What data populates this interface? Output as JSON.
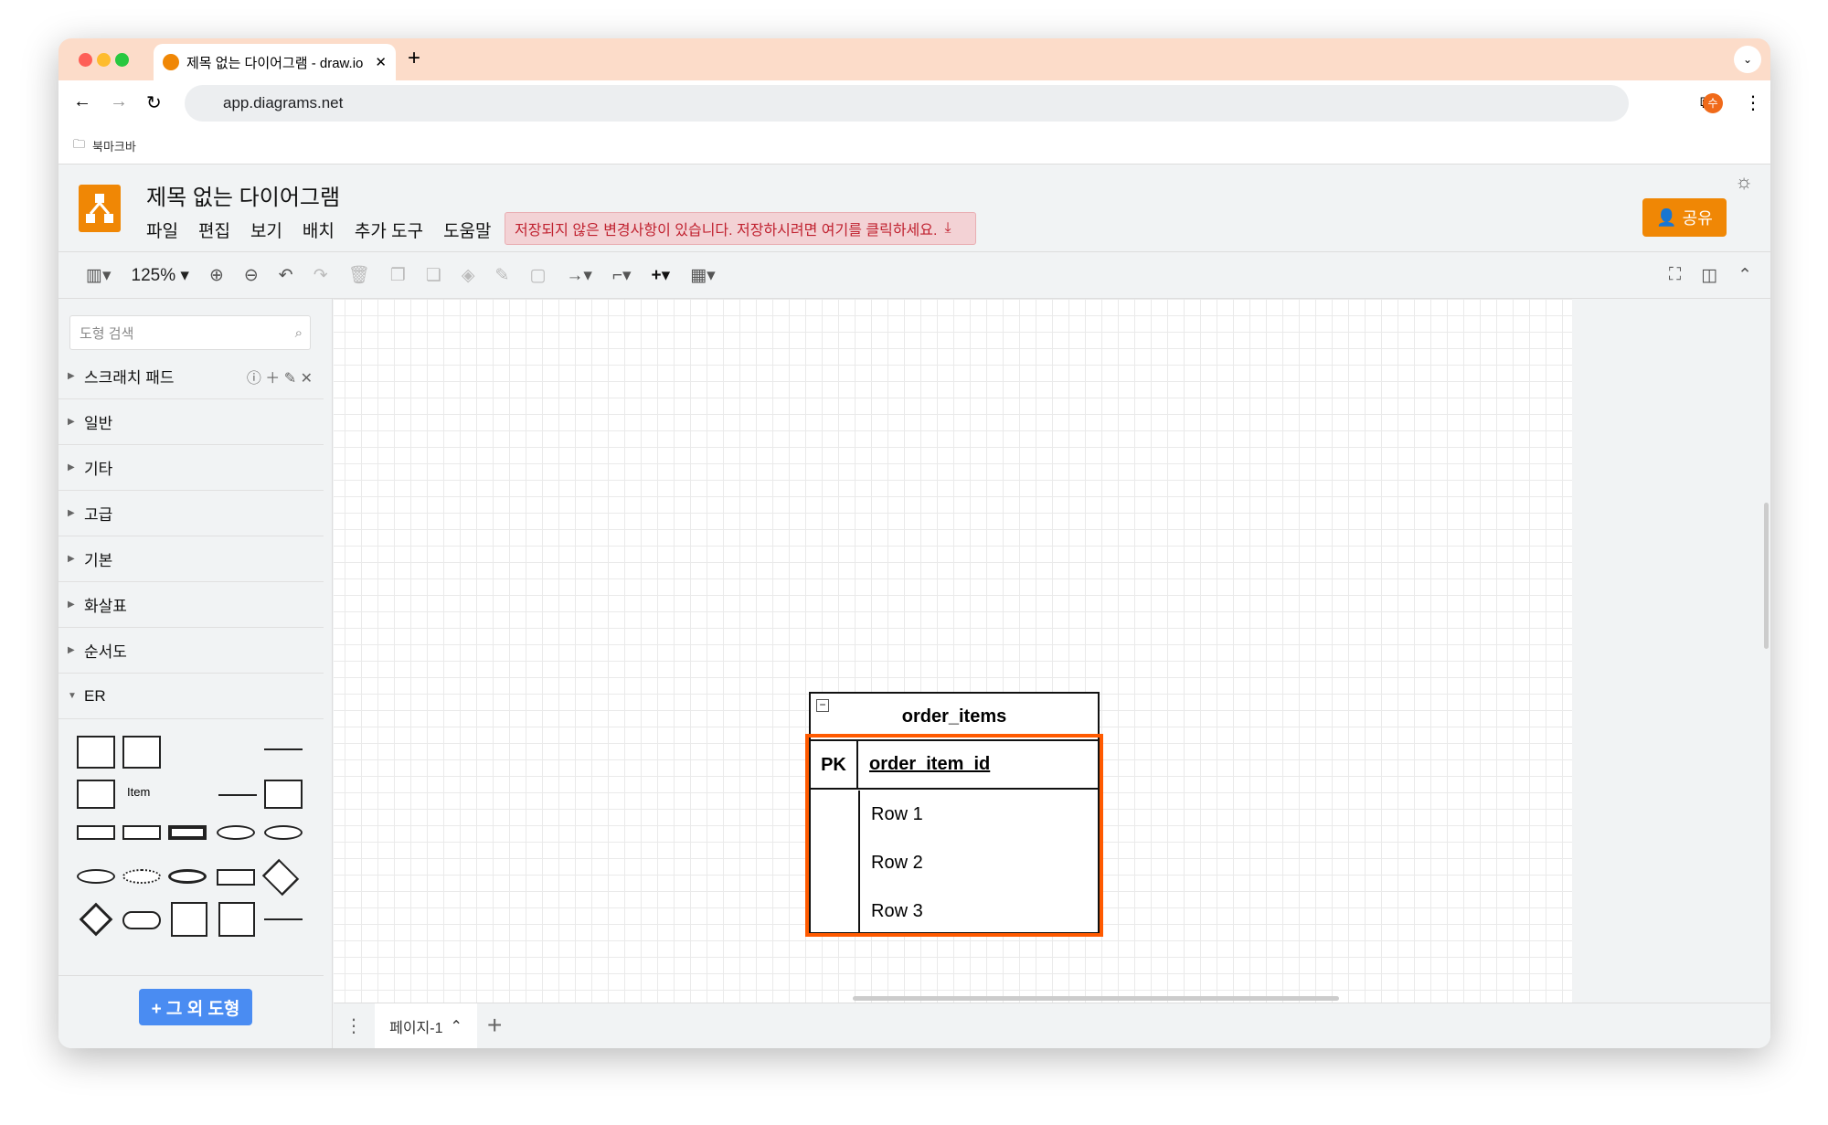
{
  "browser": {
    "tab_title": "제목 없는 다이어그램 - draw.io",
    "url": "app.diagrams.net",
    "bookmarks_label": "북마크바",
    "profile_initial": "수"
  },
  "app": {
    "title": "제목 없는 다이어그램",
    "menu": [
      "파일",
      "편집",
      "보기",
      "배치",
      "추가 도구",
      "도움말"
    ],
    "unsaved_warning": "저장되지 않은 변경사항이 있습니다. 저장하시려면 여기를 클릭하세요.",
    "share_label": "공유",
    "accent": "#f08705"
  },
  "toolbar": {
    "zoom": "125%"
  },
  "sidebar": {
    "search_placeholder": "도형 검색",
    "sections": [
      "스크래치 패드",
      "일반",
      "기타",
      "고급",
      "기본",
      "화살표",
      "순서도",
      "ER"
    ],
    "er_item_label": "Item",
    "more_shapes": "+ 그 외 도형"
  },
  "diagram": {
    "table_name": "order_items",
    "pk_label": "PK",
    "pk_field": "order_item_id",
    "rows": [
      "Row 1",
      "Row 2",
      "Row 3"
    ],
    "selection_color": "#ff5a00"
  },
  "pages": {
    "current": "페이지-1"
  }
}
